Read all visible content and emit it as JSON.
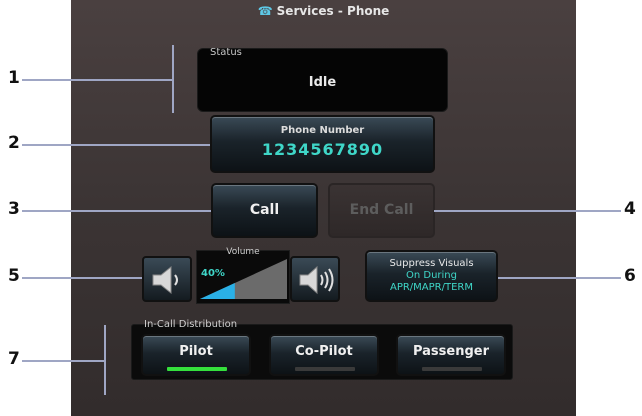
{
  "window": {
    "title": "Services - Phone",
    "title_icon": "phone-icon"
  },
  "status": {
    "label": "Status",
    "value": "Idle"
  },
  "phone_number": {
    "label": "Phone Number",
    "value": "1234567890"
  },
  "buttons": {
    "call": "Call",
    "end_call": "End Call"
  },
  "volume": {
    "label": "Volume",
    "percent_text": "40%",
    "level": 0.4
  },
  "suppress_visuals": {
    "line1": "Suppress Visuals",
    "line2": "On During",
    "line3": "APR/MAPR/TERM"
  },
  "in_call_distribution": {
    "label": "In-Call Distribution",
    "options": [
      {
        "label": "Pilot",
        "active": true
      },
      {
        "label": "Co-Pilot",
        "active": false
      },
      {
        "label": "Passenger",
        "active": false
      }
    ]
  },
  "callouts": [
    "1",
    "2",
    "3",
    "4",
    "5",
    "6",
    "7"
  ],
  "colors": {
    "accent": "#3fd6c8",
    "active_indicator": "#35e03c",
    "callout_line": "#9fa6c4"
  }
}
